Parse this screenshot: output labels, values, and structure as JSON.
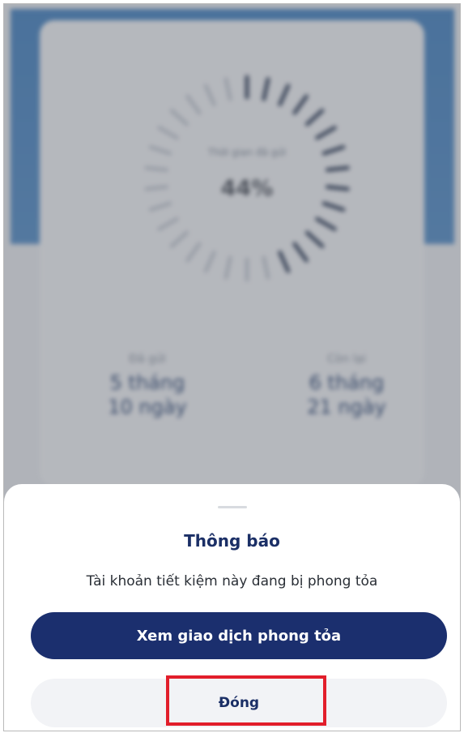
{
  "background": {
    "progress_label": "Thời gian đã gửi",
    "progress_value": "44%",
    "progress_fraction": 0.44,
    "sent": {
      "label": "Đã gửi",
      "months": "5 tháng",
      "days": "10 ngày"
    },
    "remaining": {
      "label": "Còn lại",
      "months": "6 tháng",
      "days": "21 ngày"
    }
  },
  "dialog": {
    "title": "Thông báo",
    "message": "Tài khoản tiết kiệm này đang bị phong tỏa",
    "primary_button": "Xem giao dịch phong tỏa",
    "close_button": "Đóng"
  },
  "colors": {
    "primary": "#1b2f6e",
    "highlight": "#e21e2b",
    "header_blue": "#3f7fc0"
  }
}
